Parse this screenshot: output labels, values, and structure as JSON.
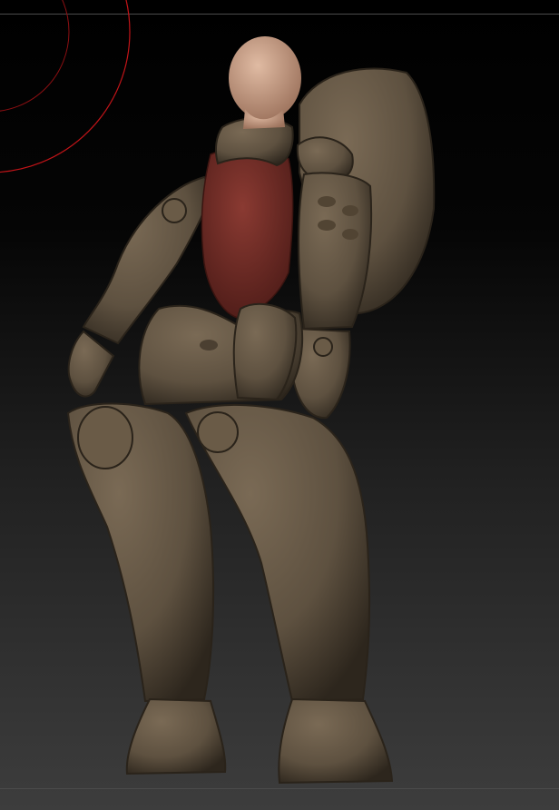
{
  "app": {
    "viewport_label": "",
    "colors": {
      "background_top": "#000000",
      "background_bottom": "#3d3d3d",
      "frame_line": "#4b4b4b",
      "gizmo_ring": "#c21418",
      "armor": "#5e5140",
      "armor_highlight": "#7a6a55",
      "armor_shadow": "#2d261d",
      "bodysuit": "#6b2a24",
      "skin": "#c99f86"
    },
    "model": {
      "name": "",
      "material": "armor-sculpt"
    },
    "gizmo": {
      "icon": "rotation-ring-icon"
    }
  }
}
